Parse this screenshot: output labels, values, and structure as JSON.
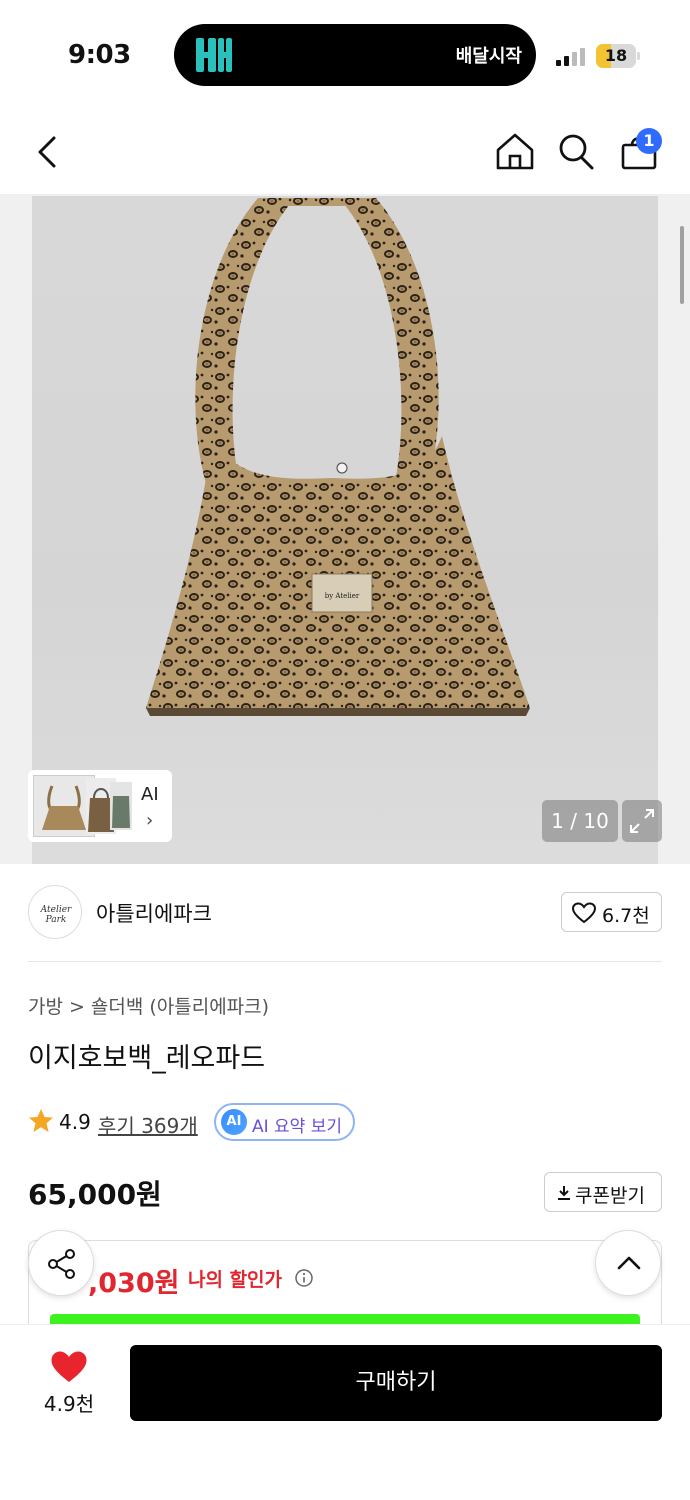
{
  "status_bar": {
    "time": "9:03",
    "island_app_text": "배달시작",
    "battery_level": "18",
    "battery_fraction": 0.18
  },
  "nav": {
    "icons": [
      "back-icon",
      "home-icon",
      "search-icon",
      "shopping-bag-icon"
    ],
    "cart_badge": "1"
  },
  "gallery": {
    "ai_label": "AI",
    "ai_arrow": "›",
    "counter": "1 / 10",
    "logo_text": "by Atelier"
  },
  "seller": {
    "logo_text": "Atelier Park",
    "name": "아틀리에파크",
    "like_count": "6.7천"
  },
  "product": {
    "breadcrumb": [
      "가방",
      ">",
      "숄더백",
      "(아틀리에파크)"
    ],
    "title": "이지호보백_레오파드",
    "rating": "4.9",
    "reviews_link": "후기 369개",
    "ai_chip": "AI",
    "ai_summary": "AI 요약 보기",
    "price": "65,000원",
    "coupon": "쿠폰받기"
  },
  "discount": {
    "price": ",030원",
    "label": "나의 할인가"
  },
  "bottom": {
    "heart_count": "4.9천",
    "buy_label": "구매하기"
  },
  "colors": {
    "accent_blue": "#2f6bff",
    "discount_red": "#e0262e",
    "bar_green": "#3cf21f",
    "buy_black": "#000000"
  }
}
